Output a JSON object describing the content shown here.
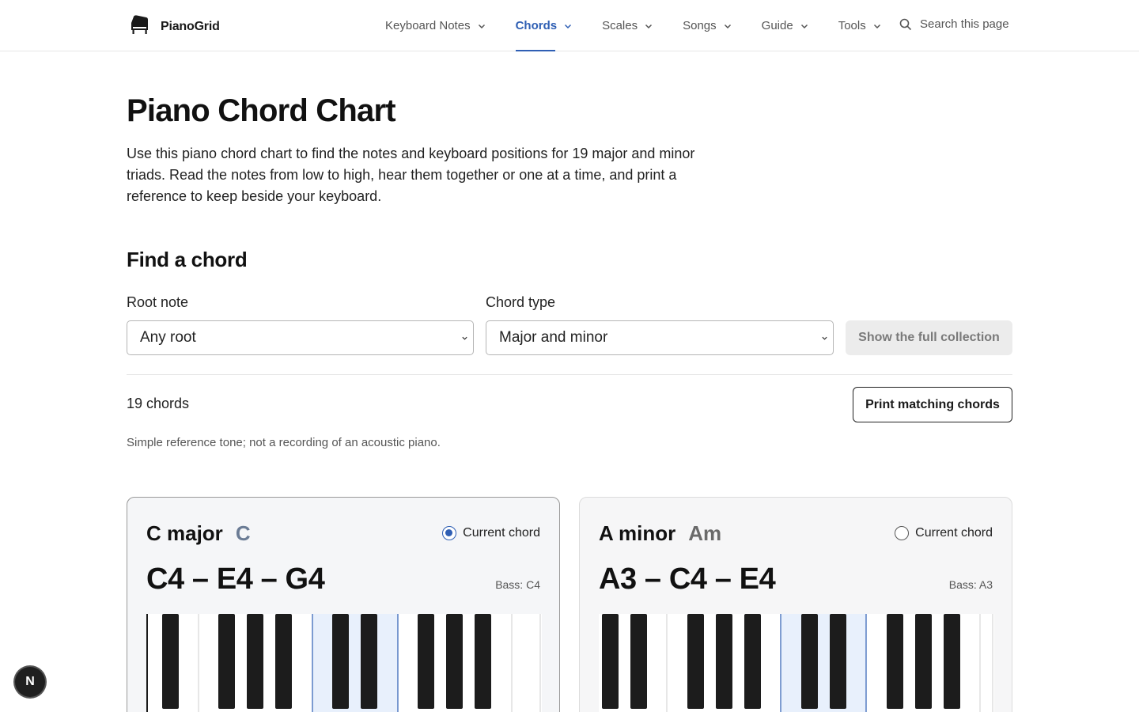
{
  "brand": {
    "name": "PianoGrid",
    "logo_icon": "grand-piano-icon"
  },
  "nav": [
    {
      "label": "Keyboard Notes",
      "active": false
    },
    {
      "label": "Chords",
      "active": true
    },
    {
      "label": "Scales",
      "active": false
    },
    {
      "label": "Songs",
      "active": false
    },
    {
      "label": "Guide",
      "active": false
    },
    {
      "label": "Tools",
      "active": false
    }
  ],
  "search": {
    "label": "Search this page",
    "icon": "search-icon"
  },
  "page": {
    "title": "Piano Chord Chart",
    "intro": "Use this piano chord chart to find the notes and keyboard positions for 19 major and minor triads. Read the notes from low to high, hear them together or one at a time, and print a reference to keep beside your keyboard."
  },
  "finder": {
    "title": "Find a chord",
    "root_label": "Root note",
    "root_value": "Any root",
    "type_label": "Chord type",
    "type_value": "Major and minor",
    "show_all_label": "Show the full collection",
    "count_text": "19 chords",
    "print_label": "Print matching chords",
    "audio_note": "Simple reference tone; not a recording of an acoustic piano."
  },
  "cards": [
    {
      "name": "C major",
      "symbol": "C",
      "radio_label": "Current chord",
      "current": true,
      "notes": "C4 – E4 – G4",
      "bass": "Bass: C4"
    },
    {
      "name": "A minor",
      "symbol": "Am",
      "radio_label": "Current chord",
      "current": false,
      "notes": "A3 – C4 – E4",
      "bass": "Bass: A3"
    }
  ],
  "floating_badge": {
    "label": "N"
  },
  "colors": {
    "accent": "#2f5fb4",
    "highlight_key": "#e8f0fc"
  }
}
